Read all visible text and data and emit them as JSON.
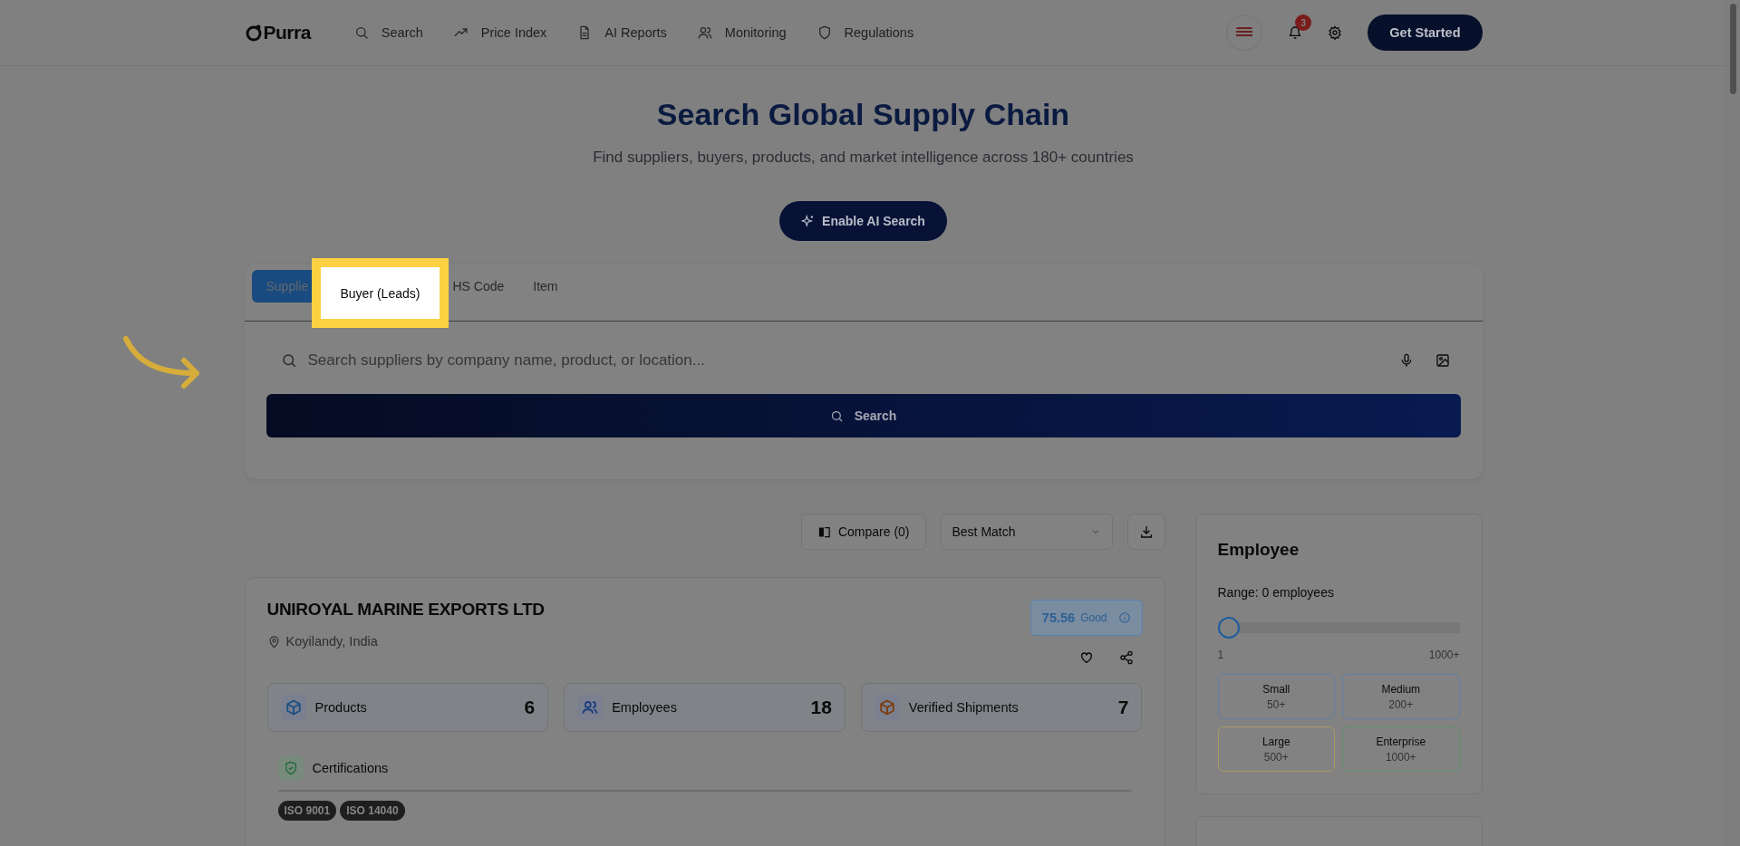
{
  "header": {
    "logo": "Purra",
    "nav": [
      {
        "label": "Search",
        "kind": "search"
      },
      {
        "label": "Price Index",
        "kind": "trend"
      },
      {
        "label": "AI Reports",
        "kind": "doc"
      },
      {
        "label": "Monitoring",
        "kind": "users"
      },
      {
        "label": "Regulations",
        "kind": "shield"
      }
    ],
    "notifications": "3",
    "cta": "Get Started"
  },
  "hero": {
    "title": "Search Global Supply Chain",
    "subtitle": "Find suppliers, buyers, products, and market intelligence across 180+ countries",
    "ai_button": "Enable AI Search"
  },
  "search": {
    "tabs": [
      {
        "label": "Supplie",
        "selected": true,
        "highlighted": false
      },
      {
        "label": "Buyer (Leads)",
        "selected": false,
        "highlighted": true
      },
      {
        "label": "HS Code",
        "selected": false,
        "highlighted": false
      },
      {
        "label": "Item",
        "selected": false,
        "highlighted": false
      }
    ],
    "placeholder": "Search suppliers by company name, product, or location...",
    "button": "Search"
  },
  "toolbar": {
    "compare": "Compare (0)",
    "sort": "Best Match"
  },
  "result": {
    "name": "UNIROYAL MARINE EXPORTS LTD",
    "location": "Koyilandy, India",
    "score": "75.56",
    "rating": "Good",
    "stats": [
      {
        "label": "Products",
        "value": "6",
        "kind": "box",
        "color": "#1d4f80"
      },
      {
        "label": "Employees",
        "value": "18",
        "kind": "users",
        "color": "#1d3f80"
      },
      {
        "label": "Verified Shipments",
        "value": "7",
        "kind": "package",
        "color": "#7a3d10"
      }
    ],
    "certifications": {
      "title": "Certifications",
      "tags": [
        "ISO 9001",
        "ISO 14040"
      ]
    }
  },
  "filter": {
    "title": "Employee",
    "range": "Range: 0 employees",
    "slider": {
      "level": 0,
      "min": "1",
      "max": "1000+"
    },
    "sizes": [
      {
        "label": "Small",
        "range": "50+",
        "color": "#5f7fa6"
      },
      {
        "label": "Medium",
        "range": "200+",
        "color": "#5f7fa6"
      },
      {
        "label": "Large",
        "range": "500+",
        "color": "#a89a60"
      },
      {
        "label": "Enterprise",
        "range": "1000+",
        "color": "#5f9070"
      }
    ]
  }
}
